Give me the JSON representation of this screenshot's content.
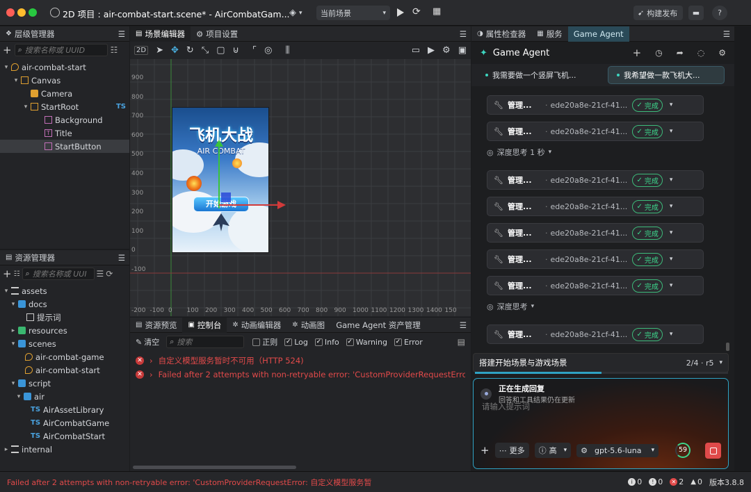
{
  "titlebar": {
    "title": "2D 项目 : air-combat-start.scene* - AirCombatGam...",
    "scene_select": "当前场景",
    "publish": "构建发布"
  },
  "hierarchy": {
    "tab": "层级管理器",
    "search_placeholder": "搜索名称或 UUID",
    "items": [
      {
        "label": "air-combat-start"
      },
      {
        "label": "Canvas"
      },
      {
        "label": "Camera"
      },
      {
        "label": "StartRoot",
        "tag": "TS"
      },
      {
        "label": "Background"
      },
      {
        "label": "Title"
      },
      {
        "label": "StartButton"
      }
    ]
  },
  "assets": {
    "tab": "资源管理器",
    "search_placeholder": "搜索名称或 UUI",
    "items": [
      {
        "label": "assets"
      },
      {
        "label": "docs"
      },
      {
        "label": "提示词"
      },
      {
        "label": "resources"
      },
      {
        "label": "scenes"
      },
      {
        "label": "air-combat-game"
      },
      {
        "label": "air-combat-start"
      },
      {
        "label": "script"
      },
      {
        "label": "air"
      },
      {
        "label": "AirAssetLibrary",
        "tag": "TS"
      },
      {
        "label": "AirCombatGame",
        "tag": "TS"
      },
      {
        "label": "AirCombatStart",
        "tag": "TS"
      },
      {
        "label": "internal"
      }
    ]
  },
  "scene_editor": {
    "tabs": [
      "场景编辑器",
      "项目设置"
    ],
    "mode": "2D",
    "y_ticks": [
      "900",
      "800",
      "700",
      "600",
      "500",
      "400",
      "300",
      "200",
      "100",
      "0",
      "-100"
    ],
    "x_ticks": [
      "-200",
      "-100",
      "0",
      "100",
      "200",
      "300",
      "400",
      "500",
      "600",
      "700",
      "800",
      "900",
      "1000",
      "1100",
      "1200",
      "1300",
      "1400",
      "150"
    ],
    "game_title": "飞机大战",
    "game_subtitle": "AIR COMBAT",
    "start_button": "开始游戏"
  },
  "console": {
    "tabs": [
      "资源预览",
      "控制台",
      "动画编辑器",
      "动画图",
      "Game Agent 资产管理"
    ],
    "clear": "清空",
    "search_placeholder": "搜索",
    "filters": [
      {
        "label": "正则",
        "checked": false
      },
      {
        "label": "Log",
        "checked": true
      },
      {
        "label": "Info",
        "checked": true
      },
      {
        "label": "Warning",
        "checked": true
      },
      {
        "label": "Error",
        "checked": true
      }
    ],
    "errors": [
      "自定义模型服务暂时不可用（HTTP 524)",
      "Failed after 2 attempts with non-retryable error: 'CustomProviderRequestError: 自定"
    ]
  },
  "right_tabs": [
    "属性检查器",
    "服务",
    "Game Agent"
  ],
  "agent": {
    "title": "Game Agent",
    "sessions": [
      "我需要做一个竖屏飞机...",
      "我希望做一款飞机大..."
    ],
    "card_title": "管理...",
    "card_id": "ede20a8e-21cf-41...",
    "card_status": "完成",
    "think1": "深度思考 1 秒",
    "think2": "深度思考",
    "task": "搭建开始场景与游戏场景",
    "task_progress": "2/4 · r5",
    "task_progress_ratio": 0.5,
    "generating_title": "正在生成回复",
    "generating_sub": "回答和工具结果仍在更新",
    "input_placeholder": "请输入提示词",
    "more": "更多",
    "level": "高",
    "model": "gpt-5.6-luna",
    "counter": "59"
  },
  "statusbar": {
    "message": "Failed after 2 attempts with non-retryable error: 'CustomProviderRequestError: 自定义模型服务暂",
    "counts": [
      "0",
      "0",
      "2",
      "0"
    ],
    "version": "版本3.8.8"
  },
  "colors": {
    "accent": "#2fa3c4",
    "success": "#3dd68c",
    "error": "#e24a4a"
  }
}
